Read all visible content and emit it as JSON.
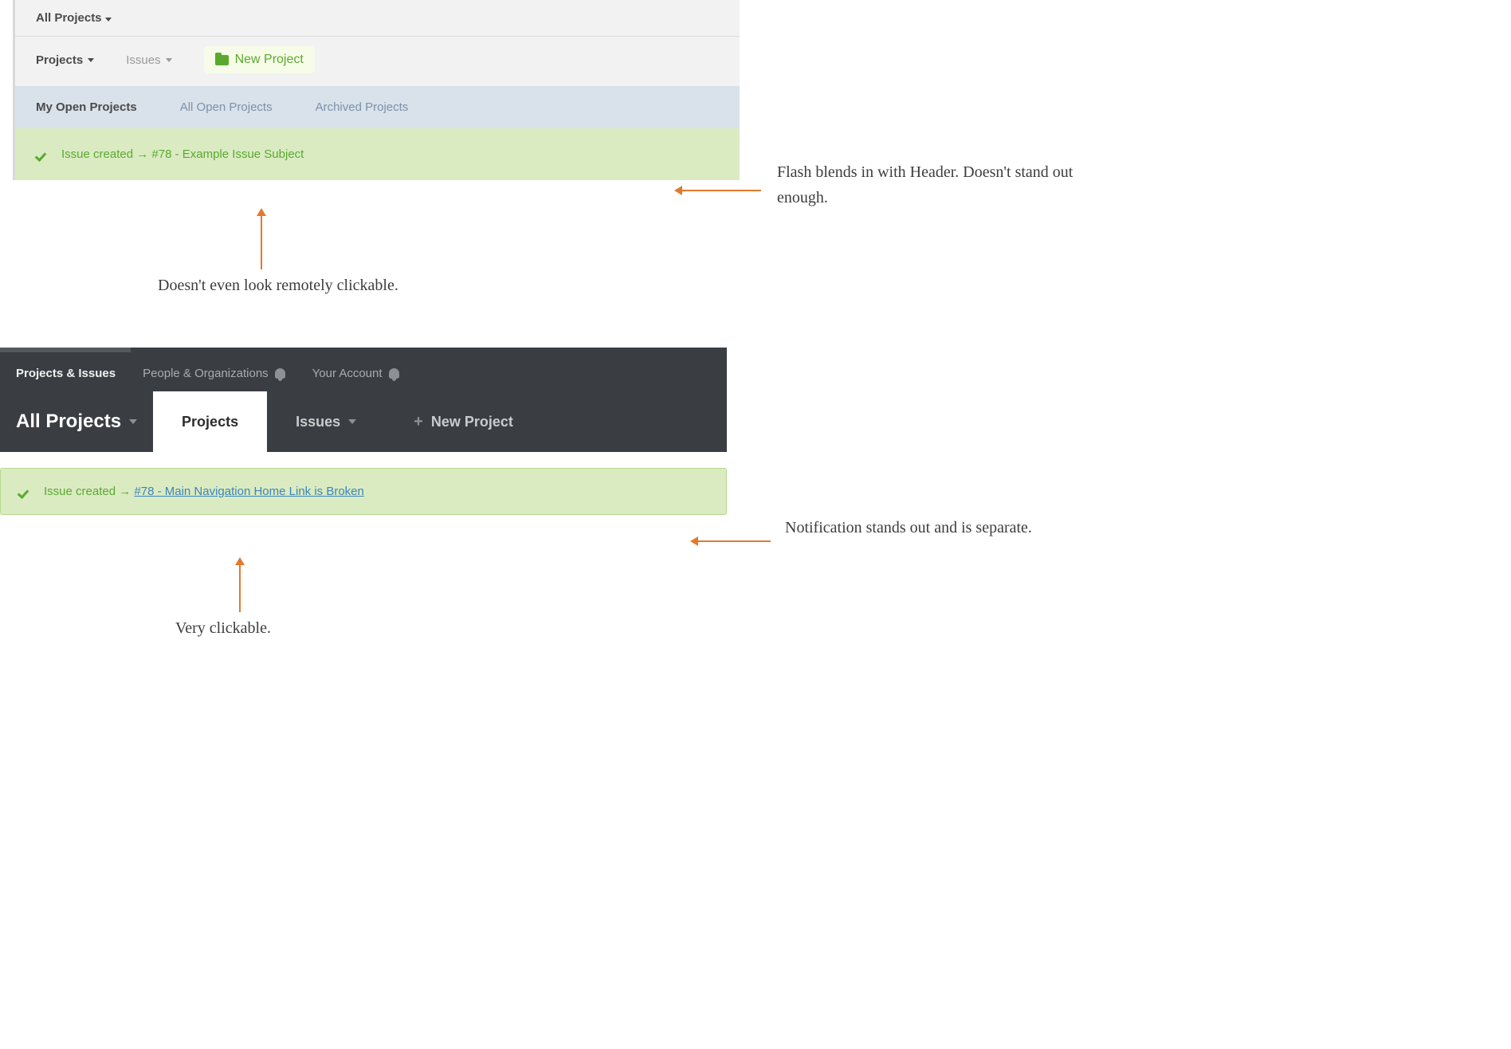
{
  "example1": {
    "all_projects_label": "All Projects",
    "nav": {
      "projects_label": "Projects",
      "issues_label": "Issues",
      "new_project_label": "New Project"
    },
    "tabs": {
      "my_open": "My Open Projects",
      "all_open": "All Open Projects",
      "archived": "Archived Projects"
    },
    "flash": {
      "prefix": "Issue created →",
      "link_text": "#78 - Example Issue Subject"
    }
  },
  "example2": {
    "topnav": {
      "projects_issues": "Projects & Issues",
      "people_orgs": "People & Organizations",
      "your_account": "Your Account"
    },
    "all_projects_label": "All Projects",
    "tabs": {
      "projects": "Projects",
      "issues": "Issues",
      "new_project": "New Project"
    },
    "flash": {
      "prefix": "Issue created →",
      "link_text": "#78 - Main Navigation Home Link is Broken"
    }
  },
  "annotations": {
    "a1": "Flash blends in with Header. Doesn't stand out enough.",
    "a2": "Doesn't even look remotely clickable.",
    "a3": "Notification stands out and is separate.",
    "a4": "Very clickable."
  }
}
